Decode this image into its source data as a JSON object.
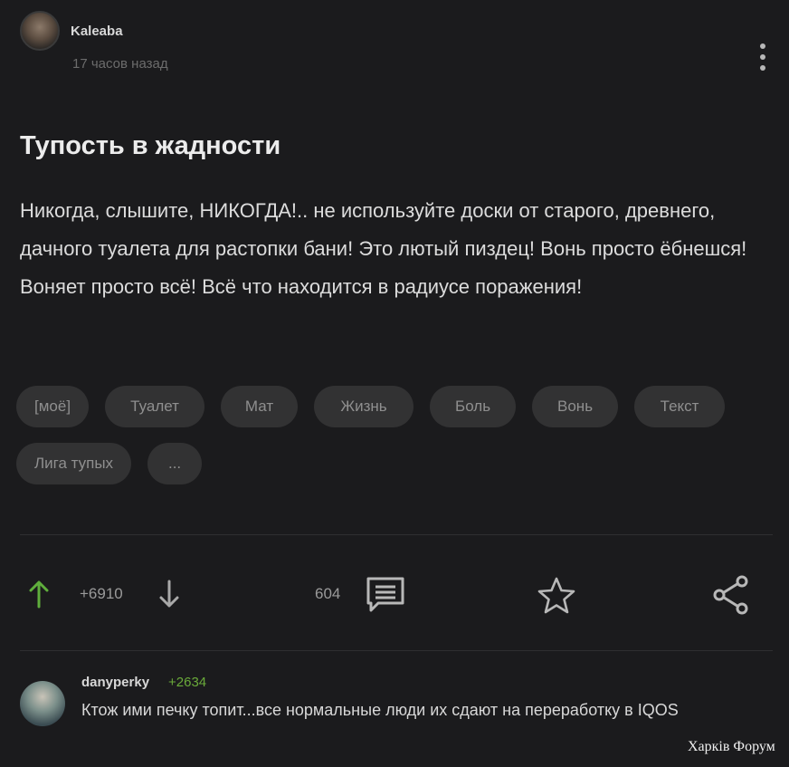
{
  "post": {
    "author": "Kaleaba",
    "time": "17 часов назад",
    "title": "Тупость в жадности",
    "body": "Никогда, слышите, НИКОГДА!.. не используйте доски от старого, древнего, дачного туалета для растопки бани! Это лютый пиздец! Вонь просто ёбнешся! Воняет просто всё! Всё что находится в радиусе поражения!",
    "tags": [
      "[моё]",
      "Туалет",
      "Мат",
      "Жизнь",
      "Боль",
      "Вонь",
      "Текст",
      "Лига тупых",
      "..."
    ]
  },
  "actions": {
    "rating": "+6910",
    "comments_count": "604"
  },
  "comment": {
    "user": "danyperky",
    "rating": "+2634",
    "text": "Ктож ими печку топит...все нормальные люди их сдают на переработку в IQOS"
  },
  "watermark": "Харків Форум",
  "colors": {
    "background": "#1b1b1d",
    "upvote": "#5fae3c",
    "comment_rating": "#6aaa3a"
  }
}
